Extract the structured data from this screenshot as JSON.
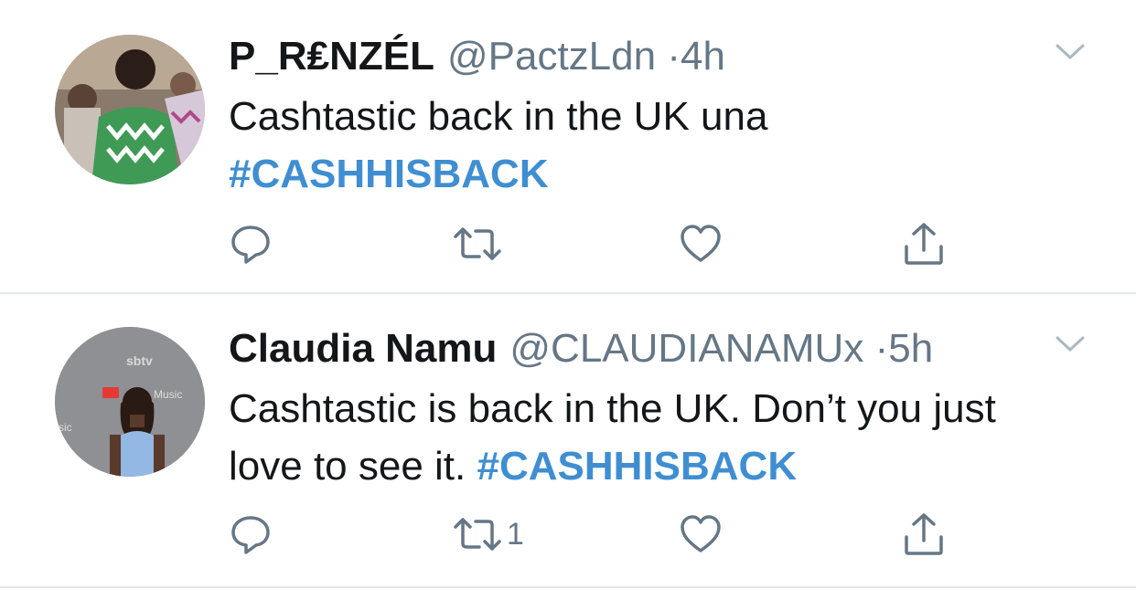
{
  "tweets": [
    {
      "name": "P_R₤NZÉL",
      "handle": "@PactzLdn",
      "separator": "·",
      "time": "4h",
      "text_before": "Cashtastic back in the UK una",
      "hashtag": "#CASHHISBACK",
      "actions": {
        "reply_count": "",
        "retweet_count": "",
        "like_count": ""
      }
    },
    {
      "name": "Claudia Namu",
      "handle": "@CLAUDIANAMUx",
      "separator": "·",
      "time": "5h",
      "text_before": "Cashtastic is back in the UK. Don’t you just love to see it.",
      "hashtag": "#CASHHISBACK",
      "actions": {
        "reply_count": "",
        "retweet_count": "1",
        "like_count": ""
      }
    }
  ],
  "colors": {
    "text": "#14171a",
    "secondary": "#657786",
    "link": "#3f8ed2",
    "divider": "#e1e8ed"
  },
  "icons": [
    "reply-icon",
    "retweet-icon",
    "like-icon",
    "share-icon",
    "chevron-down-icon"
  ]
}
